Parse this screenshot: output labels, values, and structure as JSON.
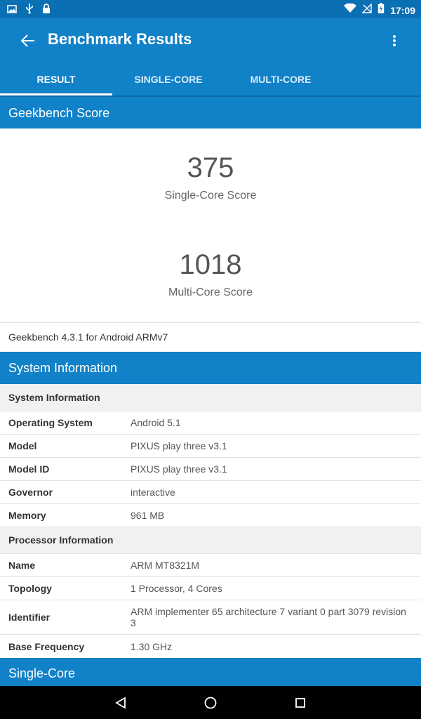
{
  "status_bar": {
    "time": "17:09"
  },
  "app_bar": {
    "title": "Benchmark Results"
  },
  "tabs": [
    {
      "label": "RESULT",
      "active": true
    },
    {
      "label": "SINGLE-CORE",
      "active": false
    },
    {
      "label": "MULTI-CORE",
      "active": false
    }
  ],
  "score_section": {
    "header": "Geekbench Score",
    "single": {
      "value": "375",
      "label": "Single-Core Score"
    },
    "multi": {
      "value": "1018",
      "label": "Multi-Core Score"
    },
    "version": "Geekbench 4.3.1 for Android ARMv7"
  },
  "system_section": {
    "header": "System Information",
    "groups": [
      {
        "title": "System Information",
        "rows": [
          {
            "key": "Operating System",
            "value": "Android 5.1"
          },
          {
            "key": "Model",
            "value": "PIXUS play three v3.1"
          },
          {
            "key": "Model ID",
            "value": "PIXUS play three v3.1"
          },
          {
            "key": "Governor",
            "value": "interactive"
          },
          {
            "key": "Memory",
            "value": "961 MB"
          }
        ]
      },
      {
        "title": "Processor Information",
        "rows": [
          {
            "key": "Name",
            "value": "ARM MT8321M"
          },
          {
            "key": "Topology",
            "value": "1 Processor, 4 Cores"
          },
          {
            "key": "Identifier",
            "value": "ARM implementer 65 architecture 7 variant 0 part 3079 revision 3"
          },
          {
            "key": "Base Frequency",
            "value": "1.30 GHz"
          }
        ]
      }
    ]
  },
  "single_core_section": {
    "header": "Single-Core"
  },
  "colors": {
    "primary": "#1181c8",
    "status_bar": "#0b6fb3"
  }
}
